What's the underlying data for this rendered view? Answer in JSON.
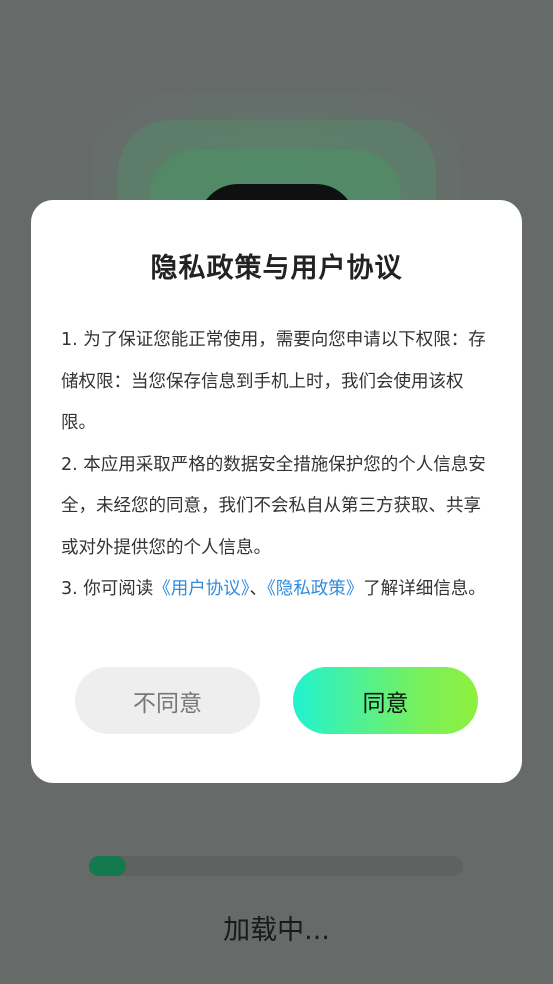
{
  "dialog": {
    "title": "隐私政策与用户协议",
    "paragraphs": {
      "p1": "1. 为了保证您能正常使用，需要向您申请以下权限：存储权限：当您保存信息到手机上时，我们会使用该权限。",
      "p2": "2. 本应用采取严格的数据安全措施保护您的个人信息安全，未经您的同意，我们不会私自从第三方获取、共享或对外提供您的个人信息。",
      "p3_prefix": "3. 你可阅读",
      "p3_link_user": "《用户协议》",
      "p3_sep": "、",
      "p3_link_privacy": "《隐私政策》",
      "p3_suffix": "了解详细信息。"
    },
    "buttons": {
      "decline": "不同意",
      "accept": "同意"
    },
    "link_color": "#2f8be0"
  },
  "loading": {
    "progress": 0.1,
    "text": "加载中..."
  },
  "colors": {
    "background": "#666a69",
    "progress_fill": "#127a4e",
    "accept_gradient_start": "#22f2d0",
    "accept_gradient_end": "#8ef03e"
  }
}
